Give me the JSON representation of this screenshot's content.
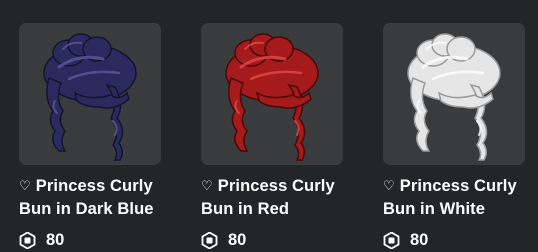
{
  "items": [
    {
      "name": "Princess Curly Bun in Dark Blue",
      "name_line1": "Princess Curly",
      "name_line2": "Bun in Dark Blue",
      "price": "80",
      "color": "#2a2a5e",
      "color_dark": "#14142e",
      "color_light": "#5a5a9a"
    },
    {
      "name": "Princess Curly Bun in Red",
      "name_line1": "Princess Curly",
      "name_line2": "Bun in Red",
      "price": "80",
      "color": "#a51a1a",
      "color_dark": "#4a0808",
      "color_light": "#e04848"
    },
    {
      "name": "Princess Curly Bun in White",
      "name_line1": "Princess Curly",
      "name_line2": "Bun in White",
      "price": "80",
      "color": "#e6e6e6",
      "color_dark": "#9a9a9a",
      "color_light": "#ffffff"
    }
  ],
  "icons": {
    "favorite": "heart-outline-icon",
    "currency": "robux-icon"
  }
}
